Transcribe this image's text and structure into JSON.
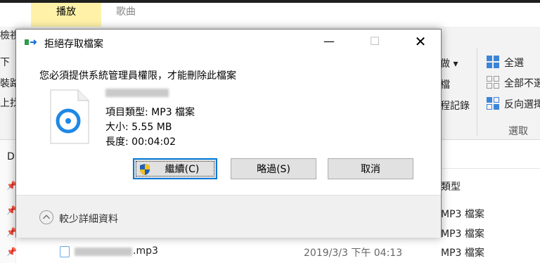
{
  "background": {
    "ribbon_tabs": [
      {
        "label": "播放"
      },
      {
        "label": "歌曲"
      }
    ],
    "left_fragments": [
      "檢視",
      "下",
      "裝路",
      "上找"
    ],
    "right_fragments": {
      "sort_label": "做 ▾",
      "row2": "檔",
      "row3": "程記錄"
    },
    "select_group": {
      "select_all": "全選",
      "select_none": "全部不選",
      "invert": "反向選擇",
      "group_label": "選取"
    },
    "list_label_d": "D",
    "type_header": "類型",
    "rows": [
      {
        "type": "MP3 檔案"
      },
      {
        "type": "MP3 檔案"
      },
      {
        "name": ".mp3",
        "date": "2019/3/3 下午 04:13",
        "type": "MP3 檔案"
      }
    ]
  },
  "dialog": {
    "title": "拒絕存取檔案",
    "message": "您必須提供系統管理員權限，才能刪除此檔案",
    "file_info": {
      "type_line": "項目類型: MP3 檔案",
      "size_line": "大小: 5.55 MB",
      "length_line": "長度: 00:04:02"
    },
    "buttons": {
      "continue": "繼續(C)",
      "skip": "略過(S)",
      "cancel": "取消"
    },
    "less_details": "較少詳細資料",
    "window_controls": {
      "minimize": "—",
      "maximize": "☐",
      "close": "✕"
    }
  },
  "colors": {
    "accent": "#0078d7",
    "ribbon_tab_active": "#fff2a8",
    "media_icon": "#1e88e5"
  }
}
